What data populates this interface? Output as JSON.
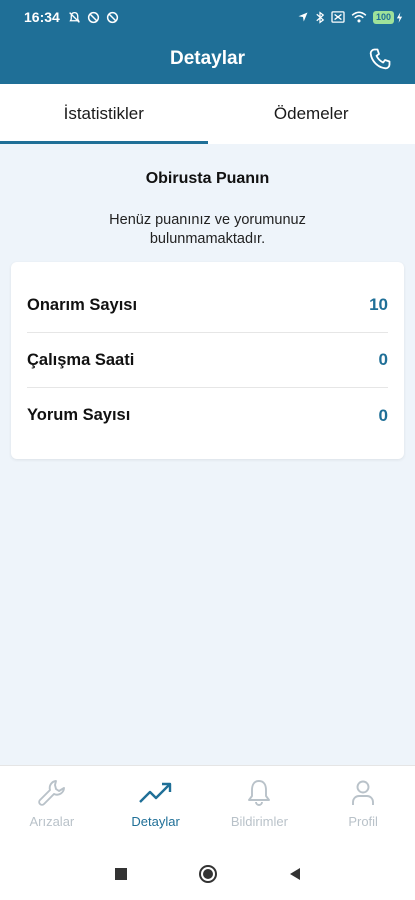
{
  "status_bar": {
    "time": "16:34",
    "battery": "100"
  },
  "app_bar": {
    "title": "Detaylar"
  },
  "tabs": [
    {
      "label": "İstatistikler",
      "active": true
    },
    {
      "label": "Ödemeler",
      "active": false
    }
  ],
  "score": {
    "title": "Obirusta Puanın",
    "message": "Henüz puanınız ve yorumunuz bulunmamaktadır."
  },
  "stats": [
    {
      "label": "Onarım Sayısı",
      "value": "10"
    },
    {
      "label": "Çalışma Saati",
      "value": "0"
    },
    {
      "label": "Yorum Sayısı",
      "value": "0"
    }
  ],
  "bottom_nav": [
    {
      "label": "Arızalar",
      "icon": "wrench-icon",
      "active": false
    },
    {
      "label": "Detaylar",
      "icon": "trending-up-icon",
      "active": true
    },
    {
      "label": "Bildirimler",
      "icon": "bell-icon",
      "active": false
    },
    {
      "label": "Profil",
      "icon": "user-icon",
      "active": false
    }
  ],
  "colors": {
    "primary": "#1f6f97",
    "inactive": "#b9c2c9",
    "background": "#eef4fa"
  }
}
